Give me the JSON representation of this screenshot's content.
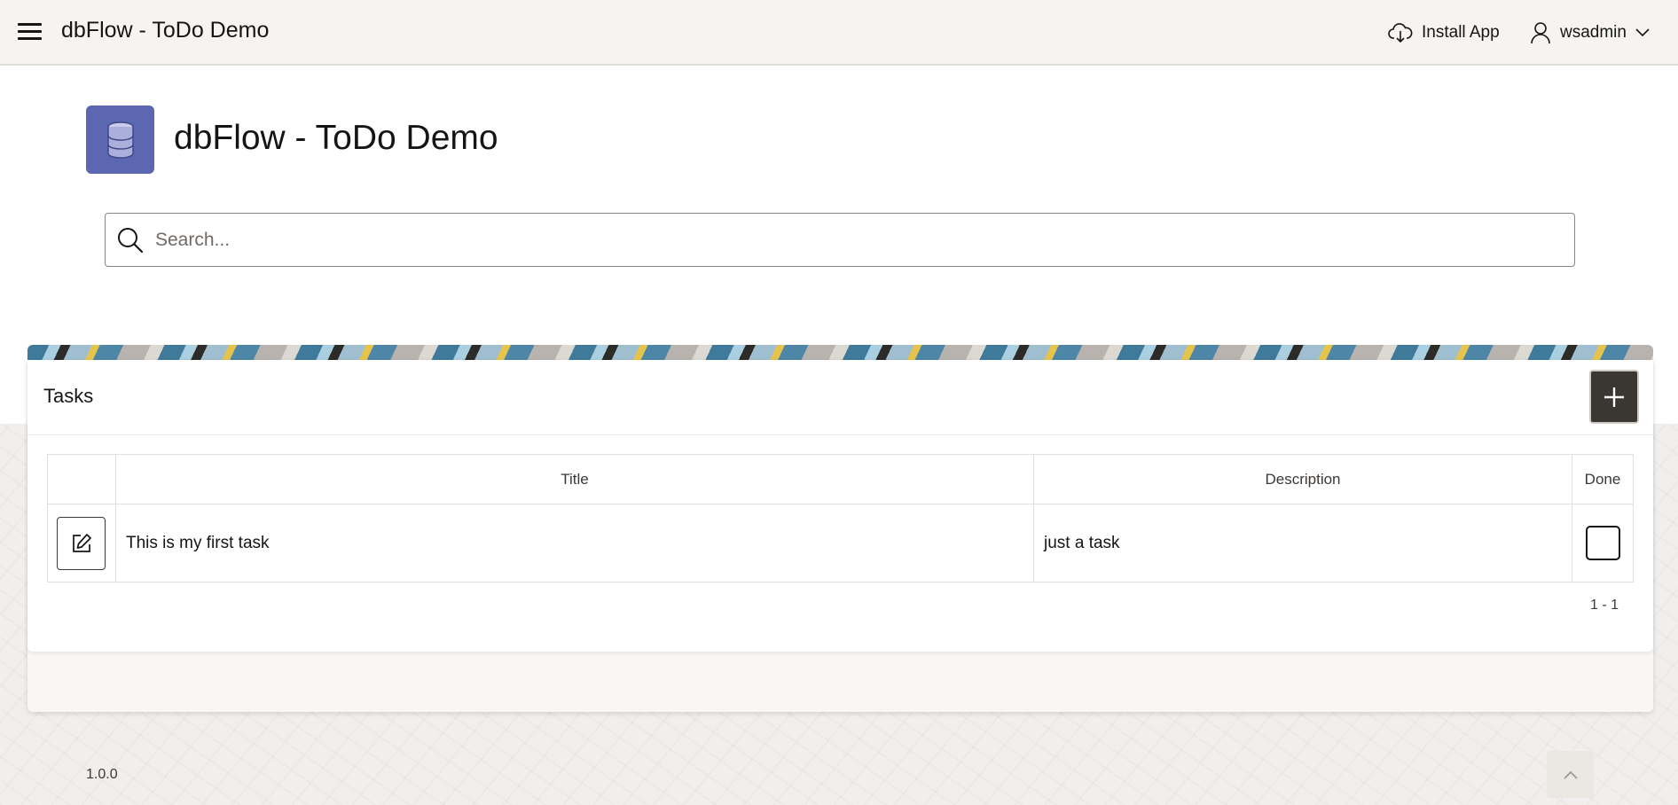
{
  "header": {
    "app_title": "dbFlow - ToDo Demo",
    "install_label": "Install App",
    "user_name": "wsadmin"
  },
  "hero": {
    "title": "dbFlow - ToDo Demo",
    "icon": "database-icon",
    "icon_color": "#5b67b0"
  },
  "search": {
    "placeholder": "Search...",
    "value": ""
  },
  "tasks_region": {
    "title": "Tasks",
    "add_icon": "plus-icon",
    "columns": [
      "",
      "Title",
      "Description",
      "Done"
    ],
    "rows": [
      {
        "title": "This is my first task",
        "description": "just a task",
        "done": false
      }
    ],
    "pagination": "1 - 1"
  },
  "footer": {
    "version": "1.0.0"
  },
  "colors": {
    "header_bg": "#f5f4f2",
    "add_button_bg": "#3a3632"
  }
}
